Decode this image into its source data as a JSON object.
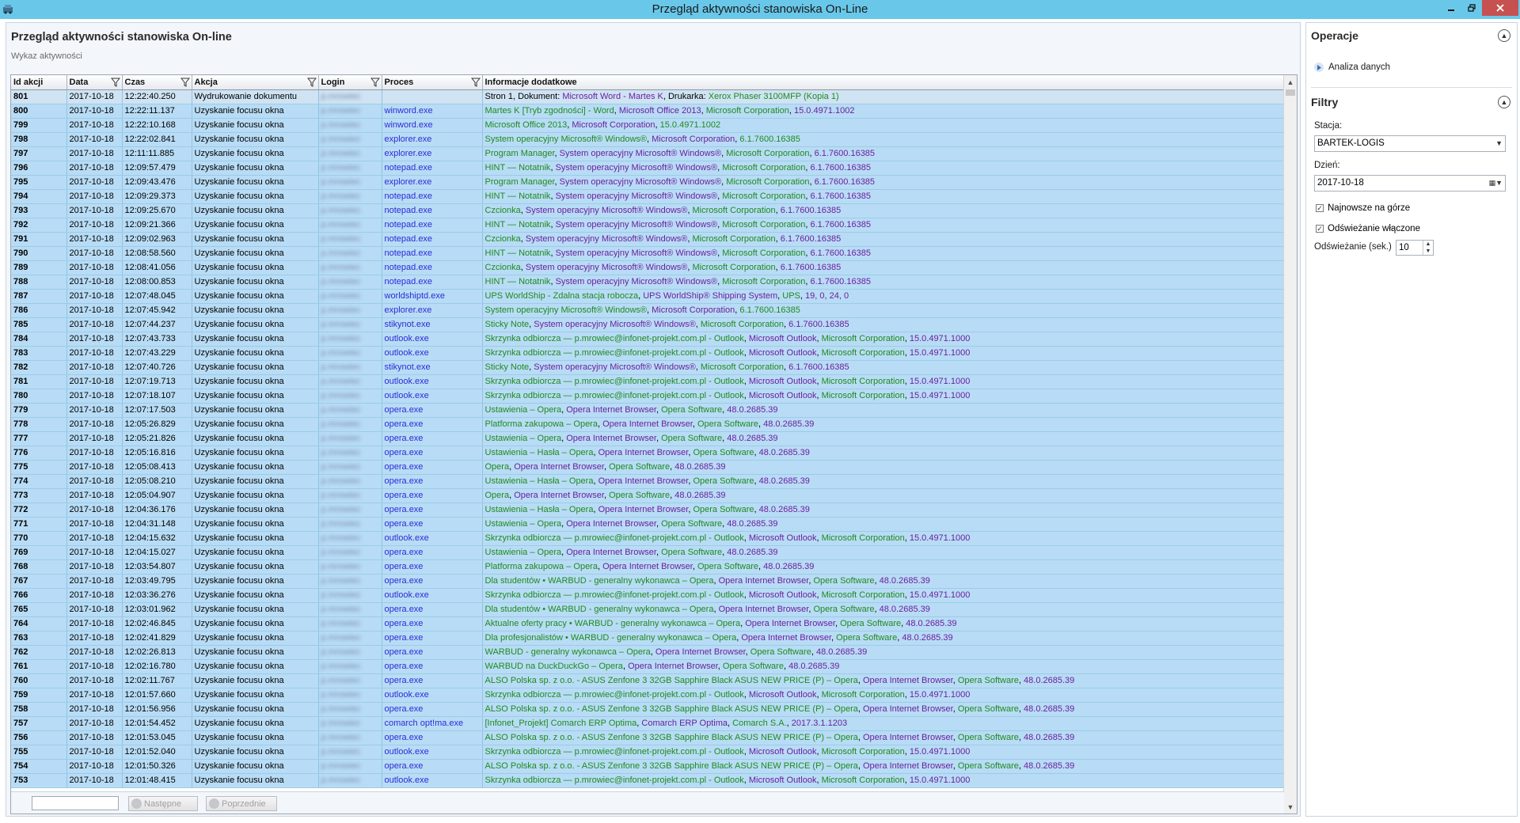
{
  "window": {
    "title": "Przegląd aktywności stanowiska On-Line"
  },
  "page": {
    "title": "Przegląd aktywności stanowiska On-line",
    "subtitle": "Wykaz aktywności"
  },
  "columns": [
    "Id akcji",
    "Data",
    "Czas",
    "Akcja",
    "Login",
    "Proces",
    "Informacje dodatkowe"
  ],
  "login_masked": "p.mrowiec",
  "rows": [
    {
      "id": "801",
      "date": "2017-10-18",
      "time": "12:22:40.250",
      "action": "Wydrukowanie dokumentu",
      "process": "",
      "info": [
        "Stron 1, Dokument: ",
        "Microsoft Word - Martes K",
        ", Drukarka: ",
        "Xerox Phaser 3100MFP (Kopia 1)"
      ]
    },
    {
      "id": "800",
      "date": "2017-10-18",
      "time": "12:22:11.137",
      "action": "Uzyskanie focusu okna",
      "process": "winword.exe",
      "info": [
        "Martes K [Tryb zgodności] - Word",
        ", ",
        "Microsoft Office 2013",
        ", ",
        "Microsoft Corporation",
        ", ",
        "15.0.4971.1002"
      ]
    },
    {
      "id": "799",
      "date": "2017-10-18",
      "time": "12:22:10.168",
      "action": "Uzyskanie focusu okna",
      "process": "winword.exe",
      "info": [
        "Microsoft Office 2013",
        ", ",
        "Microsoft Corporation",
        ", ",
        "15.0.4971.1002"
      ]
    },
    {
      "id": "798",
      "date": "2017-10-18",
      "time": "12:22:02.841",
      "action": "Uzyskanie focusu okna",
      "process": "explorer.exe",
      "info": [
        "System operacyjny Microsoft® Windows®",
        ", ",
        "Microsoft Corporation",
        ", ",
        "6.1.7600.16385"
      ]
    },
    {
      "id": "797",
      "date": "2017-10-18",
      "time": "12:11:11.885",
      "action": "Uzyskanie focusu okna",
      "process": "explorer.exe",
      "info": [
        "Program Manager",
        ", ",
        "System operacyjny Microsoft® Windows®",
        ", ",
        "Microsoft Corporation",
        ", ",
        "6.1.7600.16385"
      ]
    },
    {
      "id": "796",
      "date": "2017-10-18",
      "time": "12:09:57.479",
      "action": "Uzyskanie focusu okna",
      "process": "notepad.exe",
      "info": [
        "HINT — Notatnik",
        ", ",
        "System operacyjny Microsoft® Windows®",
        ", ",
        "Microsoft Corporation",
        ", ",
        "6.1.7600.16385"
      ]
    },
    {
      "id": "795",
      "date": "2017-10-18",
      "time": "12:09:43.476",
      "action": "Uzyskanie focusu okna",
      "process": "explorer.exe",
      "info": [
        "Program Manager",
        ", ",
        "System operacyjny Microsoft® Windows®",
        ", ",
        "Microsoft Corporation",
        ", ",
        "6.1.7600.16385"
      ]
    },
    {
      "id": "794",
      "date": "2017-10-18",
      "time": "12:09:29.373",
      "action": "Uzyskanie focusu okna",
      "process": "notepad.exe",
      "info": [
        "HINT — Notatnik",
        ", ",
        "System operacyjny Microsoft® Windows®",
        ", ",
        "Microsoft Corporation",
        ", ",
        "6.1.7600.16385"
      ]
    },
    {
      "id": "793",
      "date": "2017-10-18",
      "time": "12:09:25.670",
      "action": "Uzyskanie focusu okna",
      "process": "notepad.exe",
      "info": [
        "Czcionka",
        ", ",
        "System operacyjny Microsoft® Windows®",
        ", ",
        "Microsoft Corporation",
        ", ",
        "6.1.7600.16385"
      ]
    },
    {
      "id": "792",
      "date": "2017-10-18",
      "time": "12:09:21.366",
      "action": "Uzyskanie focusu okna",
      "process": "notepad.exe",
      "info": [
        "HINT — Notatnik",
        ", ",
        "System operacyjny Microsoft® Windows®",
        ", ",
        "Microsoft Corporation",
        ", ",
        "6.1.7600.16385"
      ]
    },
    {
      "id": "791",
      "date": "2017-10-18",
      "time": "12:09:02.963",
      "action": "Uzyskanie focusu okna",
      "process": "notepad.exe",
      "info": [
        "Czcionka",
        ", ",
        "System operacyjny Microsoft® Windows®",
        ", ",
        "Microsoft Corporation",
        ", ",
        "6.1.7600.16385"
      ]
    },
    {
      "id": "790",
      "date": "2017-10-18",
      "time": "12:08:58.560",
      "action": "Uzyskanie focusu okna",
      "process": "notepad.exe",
      "info": [
        "HINT — Notatnik",
        ", ",
        "System operacyjny Microsoft® Windows®",
        ", ",
        "Microsoft Corporation",
        ", ",
        "6.1.7600.16385"
      ]
    },
    {
      "id": "789",
      "date": "2017-10-18",
      "time": "12:08:41.056",
      "action": "Uzyskanie focusu okna",
      "process": "notepad.exe",
      "info": [
        "Czcionka",
        ", ",
        "System operacyjny Microsoft® Windows®",
        ", ",
        "Microsoft Corporation",
        ", ",
        "6.1.7600.16385"
      ]
    },
    {
      "id": "788",
      "date": "2017-10-18",
      "time": "12:08:00.853",
      "action": "Uzyskanie focusu okna",
      "process": "notepad.exe",
      "info": [
        "HINT — Notatnik",
        ", ",
        "System operacyjny Microsoft® Windows®",
        ", ",
        "Microsoft Corporation",
        ", ",
        "6.1.7600.16385"
      ]
    },
    {
      "id": "787",
      "date": "2017-10-18",
      "time": "12:07:48.045",
      "action": "Uzyskanie focusu okna",
      "process": "worldshiptd.exe",
      "info": [
        "UPS WorldShip - Zdalna stacja robocza",
        ", ",
        "UPS WorldShip® Shipping System",
        ", ",
        "UPS",
        ", ",
        "19, 0, 24, 0"
      ]
    },
    {
      "id": "786",
      "date": "2017-10-18",
      "time": "12:07:45.942",
      "action": "Uzyskanie focusu okna",
      "process": "explorer.exe",
      "info": [
        "System operacyjny Microsoft® Windows®",
        ", ",
        "Microsoft Corporation",
        ", ",
        "6.1.7600.16385"
      ]
    },
    {
      "id": "785",
      "date": "2017-10-18",
      "time": "12:07:44.237",
      "action": "Uzyskanie focusu okna",
      "process": "stikynot.exe",
      "info": [
        "Sticky Note",
        ", ",
        "System operacyjny Microsoft® Windows®",
        ", ",
        "Microsoft Corporation",
        ", ",
        "6.1.7600.16385"
      ]
    },
    {
      "id": "784",
      "date": "2017-10-18",
      "time": "12:07:43.733",
      "action": "Uzyskanie focusu okna",
      "process": "outlook.exe",
      "info": [
        "Skrzynka odbiorcza — p.mrowiec@infonet-projekt.com.pl - Outlook",
        ", ",
        "Microsoft Outlook",
        ", ",
        "Microsoft Corporation",
        ", ",
        "15.0.4971.1000"
      ]
    },
    {
      "id": "783",
      "date": "2017-10-18",
      "time": "12:07:43.229",
      "action": "Uzyskanie focusu okna",
      "process": "outlook.exe",
      "info": [
        "Skrzynka odbiorcza — p.mrowiec@infonet-projekt.com.pl - Outlook",
        ", ",
        "Microsoft Outlook",
        ", ",
        "Microsoft Corporation",
        ", ",
        "15.0.4971.1000"
      ]
    },
    {
      "id": "782",
      "date": "2017-10-18",
      "time": "12:07:40.726",
      "action": "Uzyskanie focusu okna",
      "process": "stikynot.exe",
      "info": [
        "Sticky Note",
        ", ",
        "System operacyjny Microsoft® Windows®",
        ", ",
        "Microsoft Corporation",
        ", ",
        "6.1.7600.16385"
      ]
    },
    {
      "id": "781",
      "date": "2017-10-18",
      "time": "12:07:19.713",
      "action": "Uzyskanie focusu okna",
      "process": "outlook.exe",
      "info": [
        "Skrzynka odbiorcza — p.mrowiec@infonet-projekt.com.pl - Outlook",
        ", ",
        "Microsoft Outlook",
        ", ",
        "Microsoft Corporation",
        ", ",
        "15.0.4971.1000"
      ]
    },
    {
      "id": "780",
      "date": "2017-10-18",
      "time": "12:07:18.107",
      "action": "Uzyskanie focusu okna",
      "process": "outlook.exe",
      "info": [
        "Skrzynka odbiorcza — p.mrowiec@infonet-projekt.com.pl - Outlook",
        ", ",
        "Microsoft Outlook",
        ", ",
        "Microsoft Corporation",
        ", ",
        "15.0.4971.1000"
      ]
    },
    {
      "id": "779",
      "date": "2017-10-18",
      "time": "12:07:17.503",
      "action": "Uzyskanie focusu okna",
      "process": "opera.exe",
      "info": [
        "Ustawienia – Opera",
        ", ",
        "Opera Internet Browser",
        ", ",
        "Opera Software",
        ", ",
        "48.0.2685.39"
      ]
    },
    {
      "id": "778",
      "date": "2017-10-18",
      "time": "12:05:26.829",
      "action": "Uzyskanie focusu okna",
      "process": "opera.exe",
      "info": [
        "Platforma zakupowa – Opera",
        ", ",
        "Opera Internet Browser",
        ", ",
        "Opera Software",
        ", ",
        "48.0.2685.39"
      ]
    },
    {
      "id": "777",
      "date": "2017-10-18",
      "time": "12:05:21.826",
      "action": "Uzyskanie focusu okna",
      "process": "opera.exe",
      "info": [
        "Ustawienia – Opera",
        ", ",
        "Opera Internet Browser",
        ", ",
        "Opera Software",
        ", ",
        "48.0.2685.39"
      ]
    },
    {
      "id": "776",
      "date": "2017-10-18",
      "time": "12:05:16.816",
      "action": "Uzyskanie focusu okna",
      "process": "opera.exe",
      "info": [
        "Ustawienia – Hasła – Opera",
        ", ",
        "Opera Internet Browser",
        ", ",
        "Opera Software",
        ", ",
        "48.0.2685.39"
      ]
    },
    {
      "id": "775",
      "date": "2017-10-18",
      "time": "12:05:08.413",
      "action": "Uzyskanie focusu okna",
      "process": "opera.exe",
      "info": [
        "Opera",
        ", ",
        "Opera Internet Browser",
        ", ",
        "Opera Software",
        ", ",
        "48.0.2685.39"
      ]
    },
    {
      "id": "774",
      "date": "2017-10-18",
      "time": "12:05:08.210",
      "action": "Uzyskanie focusu okna",
      "process": "opera.exe",
      "info": [
        "Ustawienia – Hasła – Opera",
        ", ",
        "Opera Internet Browser",
        ", ",
        "Opera Software",
        ", ",
        "48.0.2685.39"
      ]
    },
    {
      "id": "773",
      "date": "2017-10-18",
      "time": "12:05:04.907",
      "action": "Uzyskanie focusu okna",
      "process": "opera.exe",
      "info": [
        "Opera",
        ", ",
        "Opera Internet Browser",
        ", ",
        "Opera Software",
        ", ",
        "48.0.2685.39"
      ]
    },
    {
      "id": "772",
      "date": "2017-10-18",
      "time": "12:04:36.176",
      "action": "Uzyskanie focusu okna",
      "process": "opera.exe",
      "info": [
        "Ustawienia – Hasła – Opera",
        ", ",
        "Opera Internet Browser",
        ", ",
        "Opera Software",
        ", ",
        "48.0.2685.39"
      ]
    },
    {
      "id": "771",
      "date": "2017-10-18",
      "time": "12:04:31.148",
      "action": "Uzyskanie focusu okna",
      "process": "opera.exe",
      "info": [
        "Ustawienia – Opera",
        ", ",
        "Opera Internet Browser",
        ", ",
        "Opera Software",
        ", ",
        "48.0.2685.39"
      ]
    },
    {
      "id": "770",
      "date": "2017-10-18",
      "time": "12:04:15.632",
      "action": "Uzyskanie focusu okna",
      "process": "outlook.exe",
      "info": [
        "Skrzynka odbiorcza — p.mrowiec@infonet-projekt.com.pl - Outlook",
        ", ",
        "Microsoft Outlook",
        ", ",
        "Microsoft Corporation",
        ", ",
        "15.0.4971.1000"
      ]
    },
    {
      "id": "769",
      "date": "2017-10-18",
      "time": "12:04:15.027",
      "action": "Uzyskanie focusu okna",
      "process": "opera.exe",
      "info": [
        "Ustawienia – Opera",
        ", ",
        "Opera Internet Browser",
        ", ",
        "Opera Software",
        ", ",
        "48.0.2685.39"
      ]
    },
    {
      "id": "768",
      "date": "2017-10-18",
      "time": "12:03:54.807",
      "action": "Uzyskanie focusu okna",
      "process": "opera.exe",
      "info": [
        "Platforma zakupowa – Opera",
        ", ",
        "Opera Internet Browser",
        ", ",
        "Opera Software",
        ", ",
        "48.0.2685.39"
      ]
    },
    {
      "id": "767",
      "date": "2017-10-18",
      "time": "12:03:49.795",
      "action": "Uzyskanie focusu okna",
      "process": "opera.exe",
      "info": [
        "Dla studentów • WARBUD - generalny wykonawca – Opera",
        ", ",
        "Opera Internet Browser",
        ", ",
        "Opera Software",
        ", ",
        "48.0.2685.39"
      ]
    },
    {
      "id": "766",
      "date": "2017-10-18",
      "time": "12:03:36.276",
      "action": "Uzyskanie focusu okna",
      "process": "outlook.exe",
      "info": [
        "Skrzynka odbiorcza — p.mrowiec@infonet-projekt.com.pl - Outlook",
        ", ",
        "Microsoft Outlook",
        ", ",
        "Microsoft Corporation",
        ", ",
        "15.0.4971.1000"
      ]
    },
    {
      "id": "765",
      "date": "2017-10-18",
      "time": "12:03:01.962",
      "action": "Uzyskanie focusu okna",
      "process": "opera.exe",
      "info": [
        "Dla studentów • WARBUD - generalny wykonawca – Opera",
        ", ",
        "Opera Internet Browser",
        ", ",
        "Opera Software",
        ", ",
        "48.0.2685.39"
      ]
    },
    {
      "id": "764",
      "date": "2017-10-18",
      "time": "12:02:46.845",
      "action": "Uzyskanie focusu okna",
      "process": "opera.exe",
      "info": [
        "Aktualne oferty pracy • WARBUD - generalny wykonawca – Opera",
        ", ",
        "Opera Internet Browser",
        ", ",
        "Opera Software",
        ", ",
        "48.0.2685.39"
      ]
    },
    {
      "id": "763",
      "date": "2017-10-18",
      "time": "12:02:41.829",
      "action": "Uzyskanie focusu okna",
      "process": "opera.exe",
      "info": [
        "Dla profesjonalistów • WARBUD - generalny wykonawca – Opera",
        ", ",
        "Opera Internet Browser",
        ", ",
        "Opera Software",
        ", ",
        "48.0.2685.39"
      ]
    },
    {
      "id": "762",
      "date": "2017-10-18",
      "time": "12:02:26.813",
      "action": "Uzyskanie focusu okna",
      "process": "opera.exe",
      "info": [
        "WARBUD - generalny wykonawca – Opera",
        ", ",
        "Opera Internet Browser",
        ", ",
        "Opera Software",
        ", ",
        "48.0.2685.39"
      ]
    },
    {
      "id": "761",
      "date": "2017-10-18",
      "time": "12:02:16.780",
      "action": "Uzyskanie focusu okna",
      "process": "opera.exe",
      "info": [
        "WARBUD na DuckDuckGo – Opera",
        ", ",
        "Opera Internet Browser",
        ", ",
        "Opera Software",
        ", ",
        "48.0.2685.39"
      ]
    },
    {
      "id": "760",
      "date": "2017-10-18",
      "time": "12:02:11.767",
      "action": "Uzyskanie focusu okna",
      "process": "opera.exe",
      "info": [
        "ALSO Polska sp. z o.o. - ASUS Zenfone 3 32GB Sapphire Black ASUS NEW PRICE (P) – Opera",
        ", ",
        "Opera Internet Browser",
        ", ",
        "Opera Software",
        ", ",
        "48.0.2685.39"
      ]
    },
    {
      "id": "759",
      "date": "2017-10-18",
      "time": "12:01:57.660",
      "action": "Uzyskanie focusu okna",
      "process": "outlook.exe",
      "info": [
        "Skrzynka odbiorcza — p.mrowiec@infonet-projekt.com.pl - Outlook",
        ", ",
        "Microsoft Outlook",
        ", ",
        "Microsoft Corporation",
        ", ",
        "15.0.4971.1000"
      ]
    },
    {
      "id": "758",
      "date": "2017-10-18",
      "time": "12:01:56.956",
      "action": "Uzyskanie focusu okna",
      "process": "opera.exe",
      "info": [
        "ALSO Polska sp. z o.o. - ASUS Zenfone 3 32GB Sapphire Black ASUS NEW PRICE (P) – Opera",
        ", ",
        "Opera Internet Browser",
        ", ",
        "Opera Software",
        ", ",
        "48.0.2685.39"
      ]
    },
    {
      "id": "757",
      "date": "2017-10-18",
      "time": "12:01:54.452",
      "action": "Uzyskanie focusu okna",
      "process": "comarch opt!ma.exe",
      "info": [
        "[Infonet_Projekt] Comarch ERP Optima",
        ", ",
        "Comarch ERP Optima",
        ", ",
        "Comarch S.A.",
        ", ",
        "2017.3.1.1203"
      ]
    },
    {
      "id": "756",
      "date": "2017-10-18",
      "time": "12:01:53.045",
      "action": "Uzyskanie focusu okna",
      "process": "opera.exe",
      "info": [
        "ALSO Polska sp. z o.o. - ASUS Zenfone 3 32GB Sapphire Black ASUS NEW PRICE (P) – Opera",
        ", ",
        "Opera Internet Browser",
        ", ",
        "Opera Software",
        ", ",
        "48.0.2685.39"
      ]
    },
    {
      "id": "755",
      "date": "2017-10-18",
      "time": "12:01:52.040",
      "action": "Uzyskanie focusu okna",
      "process": "outlook.exe",
      "info": [
        "Skrzynka odbiorcza — p.mrowiec@infonet-projekt.com.pl - Outlook",
        ", ",
        "Microsoft Outlook",
        ", ",
        "Microsoft Corporation",
        ", ",
        "15.0.4971.1000"
      ]
    },
    {
      "id": "754",
      "date": "2017-10-18",
      "time": "12:01:50.326",
      "action": "Uzyskanie focusu okna",
      "process": "opera.exe",
      "info": [
        "ALSO Polska sp. z o.o. - ASUS Zenfone 3 32GB Sapphire Black ASUS NEW PRICE (P) – Opera",
        ", ",
        "Opera Internet Browser",
        ", ",
        "Opera Software",
        ", ",
        "48.0.2685.39"
      ]
    },
    {
      "id": "753",
      "date": "2017-10-18",
      "time": "12:01:48.415",
      "action": "Uzyskanie focusu okna",
      "process": "outlook.exe",
      "info": [
        "Skrzynka odbiorcza — p.mrowiec@infonet-projekt.com.pl - Outlook",
        ", ",
        "Microsoft Outlook",
        ", ",
        "Microsoft Corporation",
        ", ",
        "15.0.4971.1000"
      ]
    }
  ],
  "pager": {
    "search_value": "",
    "next_label": "Następne",
    "prev_label": "Poprzednie"
  },
  "operations": {
    "title": "Operacje",
    "items": [
      {
        "label": "Analiza danych"
      }
    ]
  },
  "filters": {
    "title": "Filtry",
    "station_label": "Stacja:",
    "station_value": "BARTEK-LOGIS",
    "day_label": "Dzień:",
    "day_value": "2017-10-18",
    "newest_top_label": "Najnowsze na górze",
    "newest_top_checked": true,
    "refresh_enabled_label": "Odświeżanie włączone",
    "refresh_enabled_checked": true,
    "refresh_interval_label": "Odświeżanie (sek.)",
    "refresh_interval_value": "10"
  },
  "colors": {
    "titlebar": "#69c8ea",
    "row": "#b8dcf5",
    "selected_row": "#cfe3f3",
    "process": "#2b2bd8",
    "info_green": "#1f8a1f",
    "info_purple": "#6b1f9e"
  }
}
